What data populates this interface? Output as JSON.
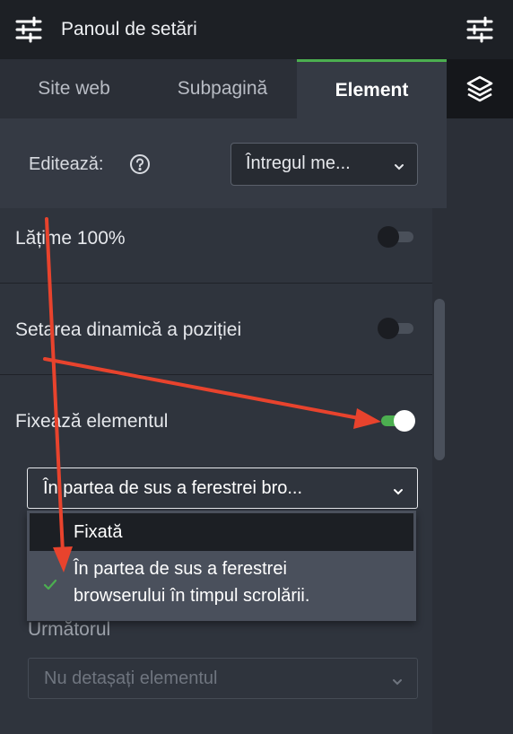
{
  "header": {
    "title": "Panoul de setări",
    "settings_icon": "sliders-icon"
  },
  "right_rail": {
    "icons": [
      "sliders-icon",
      "layers-icon"
    ]
  },
  "tabs": [
    {
      "label": "Site web",
      "active": false
    },
    {
      "label": "Subpagină",
      "active": false
    },
    {
      "label": "Element",
      "active": true
    }
  ],
  "edit": {
    "label": "Editează:",
    "help_icon": "question-circle-icon",
    "select_value": "Întregul me..."
  },
  "settings": [
    {
      "label": "Lățime 100%",
      "enabled": false
    },
    {
      "label": "Setarea dinamică a poziției",
      "enabled": false
    },
    {
      "label": "Fixează elementul",
      "enabled": true
    }
  ],
  "fix_select": {
    "value": "În partea de sus a ferestrei bro..."
  },
  "fix_options": {
    "fixed": "Fixată",
    "top_line1": "În partea de sus a ferestrei",
    "top_line2": "browserului în timpul scrolării."
  },
  "next": {
    "label": "Următorul",
    "placeholder": "Nu detașați elementul"
  },
  "colors": {
    "accent": "#4caf50",
    "annotation_arrow": "#e8432d",
    "panel_bg": "#2f343d",
    "header_bg": "#1d2025"
  }
}
